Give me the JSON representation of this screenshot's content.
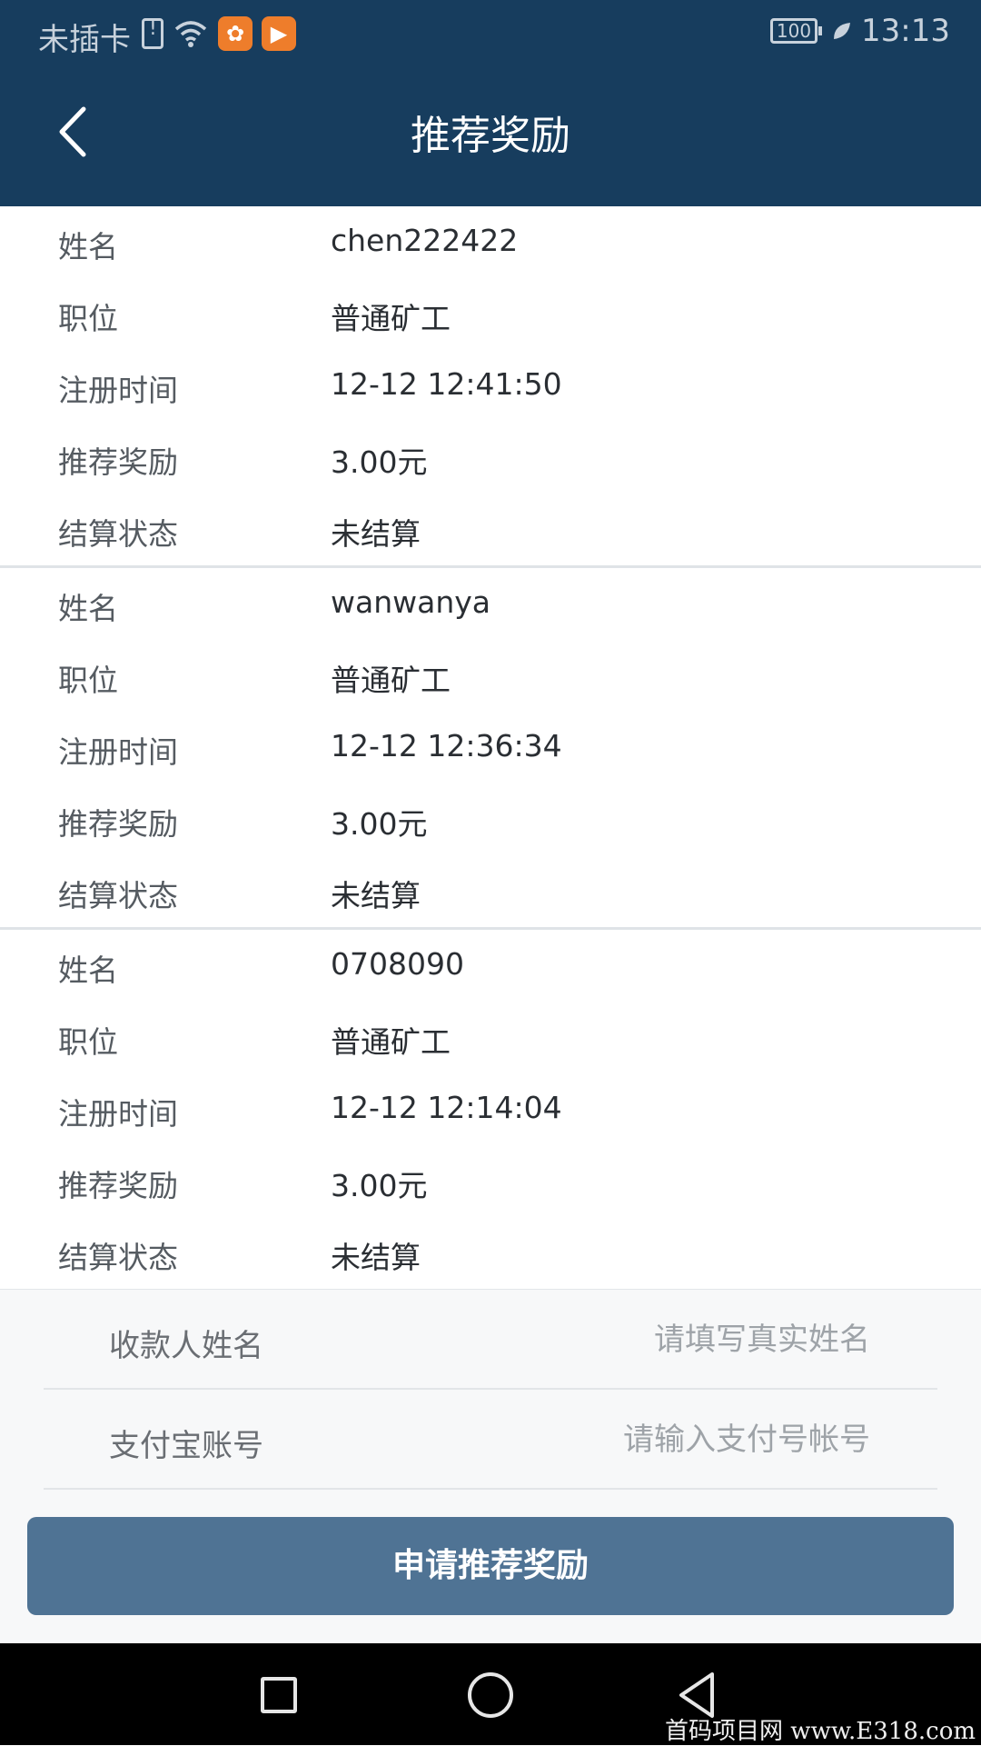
{
  "status_bar": {
    "carrier": "未插卡",
    "battery": "100",
    "time": "13:13"
  },
  "header": {
    "title": "推荐奖励"
  },
  "records": [
    {
      "name_label": "姓名",
      "name": "chen222422",
      "position_label": "职位",
      "position": "普通矿工",
      "reg_time_label": "注册时间",
      "reg_time": "12-12 12:41:50",
      "reward_label": "推荐奖励",
      "reward": "3.00元",
      "settle_label": "结算状态",
      "settle": "未结算"
    },
    {
      "name_label": "姓名",
      "name": "wanwanya",
      "position_label": "职位",
      "position": "普通矿工",
      "reg_time_label": "注册时间",
      "reg_time": "12-12 12:36:34",
      "reward_label": "推荐奖励",
      "reward": "3.00元",
      "settle_label": "结算状态",
      "settle": "未结算"
    },
    {
      "name_label": "姓名",
      "name": "0708090",
      "position_label": "职位",
      "position": "普通矿工",
      "reg_time_label": "注册时间",
      "reg_time": "12-12 12:14:04",
      "reward_label": "推荐奖励",
      "reward": "3.00元",
      "settle_label": "结算状态",
      "settle": "未结算"
    }
  ],
  "form": {
    "payee_label": "收款人姓名",
    "payee_placeholder": "请填写真实姓名",
    "payee_value": "",
    "alipay_label": "支付宝账号",
    "alipay_placeholder": "请输入支付号帐号",
    "alipay_value": "",
    "submit_label": "申请推荐奖励"
  },
  "watermark": "首码项目网 www.E318.com",
  "colors": {
    "header_bg": "#173d5e",
    "button_bg": "#4f7394",
    "app_badge": "#ee7d2b"
  },
  "icons": [
    "sim-alert-icon",
    "wifi-icon",
    "uc-browser-icon",
    "video-app-icon",
    "battery-icon",
    "leaf-icon",
    "back-arrow-icon",
    "nav-recents-icon",
    "nav-home-icon",
    "nav-back-icon"
  ]
}
